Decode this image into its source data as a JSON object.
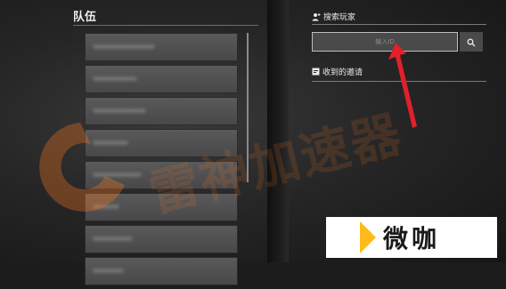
{
  "team": {
    "title": "队伍",
    "slot_count": 8
  },
  "search": {
    "header": "搜索玩家",
    "placeholder": "输入ID",
    "button_icon": "search-icon"
  },
  "invites": {
    "header": "收到的邀请"
  },
  "watermarks": {
    "badge_text": "微咖",
    "overlay_text": "雷神加速器"
  },
  "colors": {
    "annotation_arrow": "#e0202a",
    "watermark_orange": "#ff7a1a",
    "panel_slot": "#505052"
  }
}
